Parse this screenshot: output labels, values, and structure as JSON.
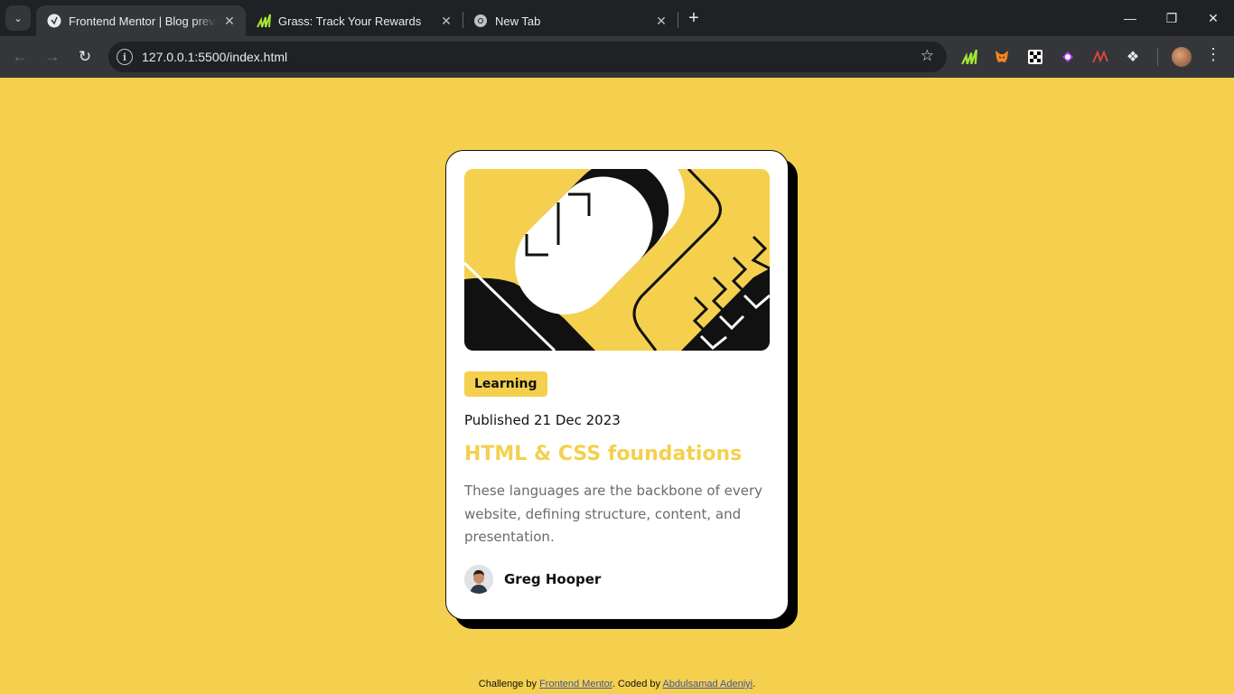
{
  "browser": {
    "tabs": [
      {
        "title": "Frontend Mentor | Blog preview card",
        "active": true
      },
      {
        "title": "Grass: Track Your Rewards",
        "active": false
      },
      {
        "title": "New Tab",
        "active": false
      }
    ],
    "url": "127.0.0.1:5500/index.html",
    "accent_color": "#202124"
  },
  "card": {
    "category": "Learning",
    "published": "Published 21 Dec 2023",
    "title": "HTML & CSS foundations",
    "description": "These languages are the backbone of every website, defining structure, content, and presentation.",
    "author": "Greg Hooper"
  },
  "footer": {
    "prefix": "Challenge by ",
    "challenge_link": "Frontend Mentor",
    "middle": ". Coded by ",
    "coder_link": "Abdulsamad Adeniyi",
    "suffix": "."
  },
  "colors": {
    "page_background": "#f4d04e",
    "card_background": "#ffffff",
    "shadow": "#000000",
    "link": "#3e52a3"
  },
  "icons": [
    "tab-search-icon",
    "close-icon",
    "plus-icon",
    "back-arrow-icon",
    "forward-arrow-icon",
    "reload-icon",
    "site-info-icon",
    "star-icon",
    "grass-extension-icon",
    "metamask-extension-icon",
    "extension-icon",
    "puzzle-icon",
    "kebab-menu-icon"
  ]
}
